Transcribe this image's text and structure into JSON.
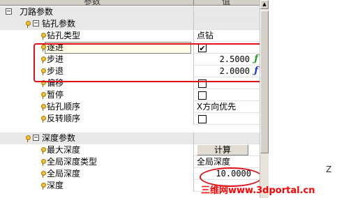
{
  "header": {
    "param_col": "参数",
    "value_col": "值"
  },
  "rows": [
    {
      "kind": "group",
      "toggle": "−",
      "label": "刀路参数"
    },
    {
      "kind": "group",
      "toggle": "−",
      "label": "钻孔参数"
    },
    {
      "kind": "param",
      "label": "钻孔类型",
      "value": "点钻"
    },
    {
      "kind": "param",
      "label": "逐进",
      "value": "✔"
    },
    {
      "kind": "param",
      "label": "步进",
      "value": "2.5000",
      "fx": "ƒ",
      "fx_color": "#1a9a1a"
    },
    {
      "kind": "param",
      "label": "步退",
      "value": "2.0000",
      "fx": "ƒ",
      "fx_color": "#1030d0"
    },
    {
      "kind": "param",
      "label": "偏移",
      "value": ""
    },
    {
      "kind": "param",
      "label": "暂停",
      "value": ""
    },
    {
      "kind": "param",
      "label": "钻孔顺序",
      "value": "X方向优先"
    },
    {
      "kind": "param",
      "label": "反转顺序",
      "value": ""
    },
    {
      "kind": "group",
      "toggle": "−",
      "label": "深度参数"
    },
    {
      "kind": "param",
      "label": "最大深度",
      "value": "计算"
    },
    {
      "kind": "param",
      "label": "全局深度类型",
      "value": "全局深度"
    },
    {
      "kind": "param",
      "label": "全局深度",
      "value": "10.0000"
    },
    {
      "kind": "param",
      "label": "深度",
      "value": ""
    }
  ],
  "viewport": {
    "axis_label": "Z"
  },
  "watermark": "三维网www.3dportal.cn",
  "colors": {
    "highlight": "#e0101a",
    "group_bg": "#e8e8e8",
    "watermark": "#ff0000"
  }
}
